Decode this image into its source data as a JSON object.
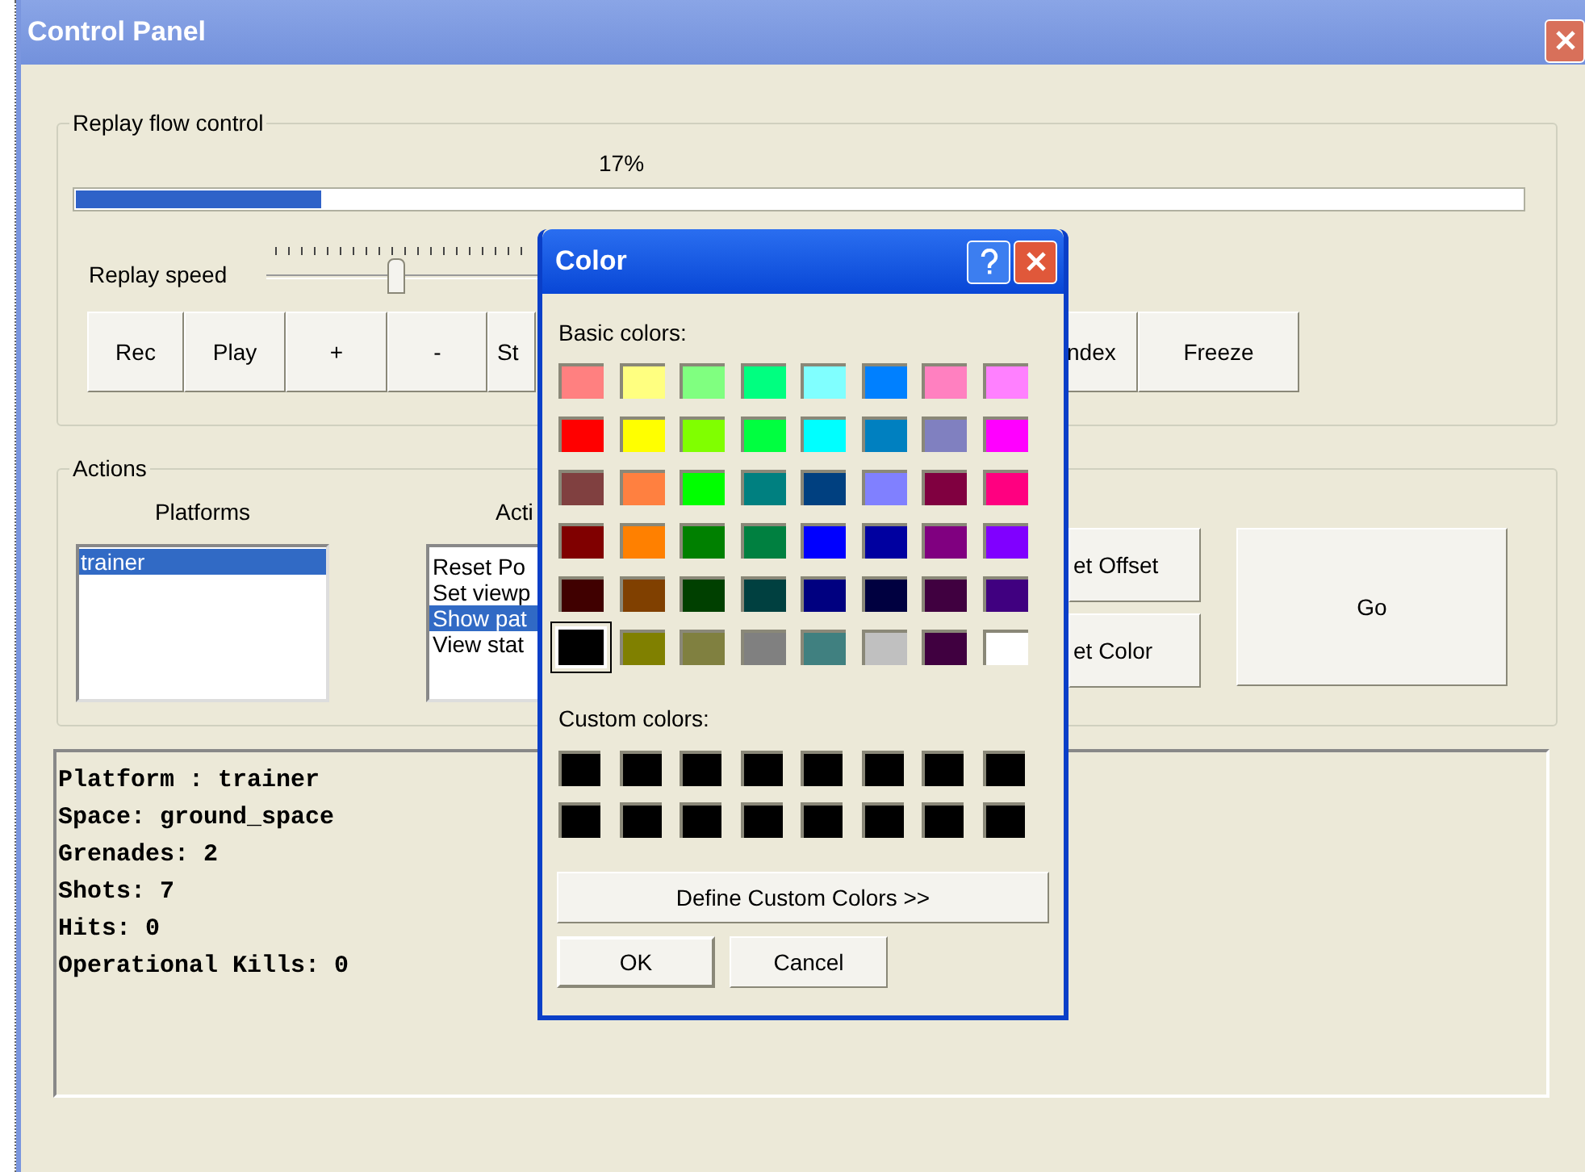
{
  "window": {
    "title": "Control Panel"
  },
  "replay_flow_control": {
    "label": "Replay flow control",
    "progress": {
      "reading": "17%",
      "level": 0.17
    },
    "speed": {
      "label": "Replay speed",
      "level": 0.4
    },
    "left_buttons": [
      "Rec",
      "Play",
      "+",
      "-",
      "St"
    ],
    "right_buttons": [
      "ndex",
      "Freeze"
    ]
  },
  "actions": {
    "label": "Actions",
    "platforms": {
      "label": "Platforms",
      "items": [
        {
          "text": "trainer",
          "selected": true
        }
      ]
    },
    "action_list": {
      "label": "Acti",
      "items": [
        {
          "text": "Reset Po",
          "selected": false
        },
        {
          "text": "Set viewp",
          "selected": false
        },
        {
          "text": "Show pat",
          "selected": true
        },
        {
          "text": "View stat",
          "selected": false
        }
      ]
    },
    "side_buttons": [
      "et Offset",
      "et Color"
    ],
    "go_button": "Go"
  },
  "output": {
    "lines": [
      "Platform : trainer",
      "Space: ground_space",
      "Grenades: 2",
      "Shots: 7",
      "Hits: 0",
      "Operational Kills: 0"
    ]
  },
  "color_dialog": {
    "title": "Color",
    "basic_label": "Basic colors:",
    "basic_colors": [
      {
        "color": "#ff8080",
        "selected": false
      },
      {
        "color": "#ffff80",
        "selected": false
      },
      {
        "color": "#80ff80",
        "selected": false
      },
      {
        "color": "#00ff80",
        "selected": false
      },
      {
        "color": "#80ffff",
        "selected": false
      },
      {
        "color": "#0080ff",
        "selected": false
      },
      {
        "color": "#ff80c0",
        "selected": false
      },
      {
        "color": "#ff80ff",
        "selected": false
      },
      {
        "color": "#ff0000",
        "selected": false
      },
      {
        "color": "#ffff00",
        "selected": false
      },
      {
        "color": "#80ff00",
        "selected": false
      },
      {
        "color": "#00ff40",
        "selected": false
      },
      {
        "color": "#00ffff",
        "selected": false
      },
      {
        "color": "#0080c0",
        "selected": false
      },
      {
        "color": "#8080c0",
        "selected": false
      },
      {
        "color": "#ff00ff",
        "selected": false
      },
      {
        "color": "#804040",
        "selected": false
      },
      {
        "color": "#ff8040",
        "selected": false
      },
      {
        "color": "#00ff00",
        "selected": false
      },
      {
        "color": "#008080",
        "selected": false
      },
      {
        "color": "#004080",
        "selected": false
      },
      {
        "color": "#8080ff",
        "selected": false
      },
      {
        "color": "#800040",
        "selected": false
      },
      {
        "color": "#ff0080",
        "selected": false
      },
      {
        "color": "#800000",
        "selected": false
      },
      {
        "color": "#ff8000",
        "selected": false
      },
      {
        "color": "#008000",
        "selected": false
      },
      {
        "color": "#008040",
        "selected": false
      },
      {
        "color": "#0000ff",
        "selected": false
      },
      {
        "color": "#0000a0",
        "selected": false
      },
      {
        "color": "#800080",
        "selected": false
      },
      {
        "color": "#8000ff",
        "selected": false
      },
      {
        "color": "#400000",
        "selected": false
      },
      {
        "color": "#804000",
        "selected": false
      },
      {
        "color": "#004000",
        "selected": false
      },
      {
        "color": "#004040",
        "selected": false
      },
      {
        "color": "#000080",
        "selected": false
      },
      {
        "color": "#000040",
        "selected": false
      },
      {
        "color": "#400040",
        "selected": false
      },
      {
        "color": "#400080",
        "selected": false
      },
      {
        "color": "#000000",
        "selected": true
      },
      {
        "color": "#808000",
        "selected": false
      },
      {
        "color": "#808040",
        "selected": false
      },
      {
        "color": "#808080",
        "selected": false
      },
      {
        "color": "#408080",
        "selected": false
      },
      {
        "color": "#c0c0c0",
        "selected": false
      },
      {
        "color": "#400040",
        "selected": false
      },
      {
        "color": "#ffffff",
        "selected": false
      }
    ],
    "custom_label": "Custom colors:",
    "custom_colors": [
      {
        "color": "#000000"
      },
      {
        "color": "#000000"
      },
      {
        "color": "#000000"
      },
      {
        "color": "#000000"
      },
      {
        "color": "#000000"
      },
      {
        "color": "#000000"
      },
      {
        "color": "#000000"
      },
      {
        "color": "#000000"
      },
      {
        "color": "#000000"
      },
      {
        "color": "#000000"
      },
      {
        "color": "#000000"
      },
      {
        "color": "#000000"
      },
      {
        "color": "#000000"
      },
      {
        "color": "#000000"
      },
      {
        "color": "#000000"
      },
      {
        "color": "#000000"
      }
    ],
    "define_button": "Define Custom Colors >>",
    "ok_button": "OK",
    "cancel_button": "Cancel"
  }
}
